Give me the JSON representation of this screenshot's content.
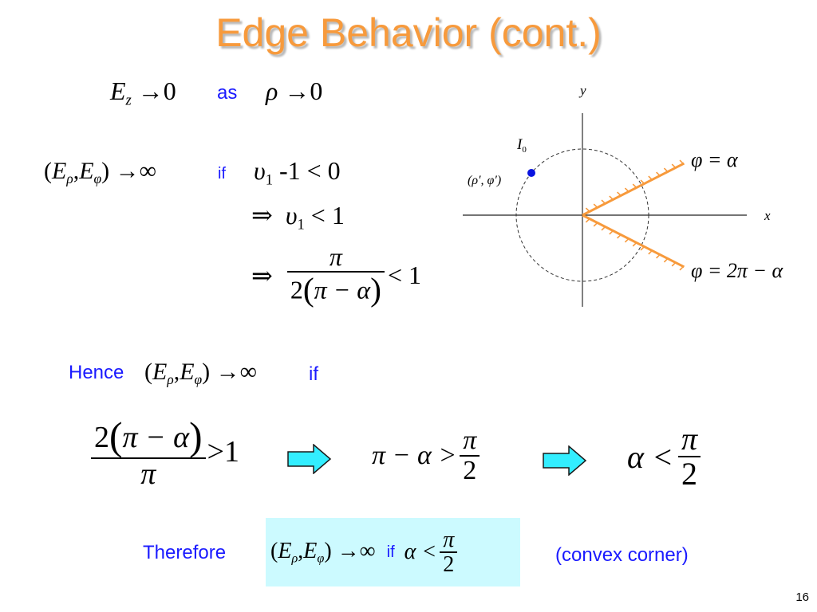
{
  "slide": {
    "title": "Edge Behavior (cont.)",
    "page_number": "16",
    "colors": {
      "title": "#f79a3c",
      "title_shadow": "#b8b8b8",
      "keyword_text": "#1a1aff",
      "edge_lines": "#f79a3c",
      "source_point": "#0a14e0",
      "arrow_fill": "#33eeff",
      "highlight_box": "#ccfaff"
    }
  },
  "line1": {
    "lhs_E": "E",
    "lhs_sub": "z",
    "arrow": "→",
    "rhs": "0",
    "keyword": "as",
    "var": "ρ",
    "var_arrow": "→",
    "var_rhs": "0"
  },
  "line2": {
    "lhs": {
      "open": "(",
      "E1": "E",
      "sub1": "ρ",
      "comma": ",",
      "E2": "E",
      "sub2": "φ",
      "close": ")",
      "arrow": "→",
      "inf": "∞"
    },
    "keyword": "if",
    "cond": {
      "nu": "υ",
      "sub": "1",
      "rest": " -1 < 0"
    }
  },
  "line3": {
    "implies": "⇒",
    "nu": "υ",
    "sub": "1",
    "rest": " < 1"
  },
  "line4": {
    "implies": "⇒",
    "num": "π",
    "den_pre": "2",
    "den_paren_open": "(",
    "den_inner": "π − α",
    "den_paren_close": ")",
    "rest": "< 1"
  },
  "diagram": {
    "y_label": "y",
    "x_label": "x",
    "source_label": "I",
    "source_sub": "0",
    "source_coords": "(ρ′, φ′)",
    "edge_upper_label": "φ = α",
    "edge_lower_label": "φ = 2π − α"
  },
  "hence": {
    "keyword": "Hence",
    "lhs": {
      "open": "(",
      "E1": "E",
      "sub1": "ρ",
      "comma": ",",
      "E2": "E",
      "sub2": "φ",
      "close": ")",
      "arrow": "→",
      "inf": "∞"
    },
    "if": "if"
  },
  "chain": {
    "step1": {
      "num_pre": "2",
      "num_open": "(",
      "num_inner": "π − α",
      "num_close": ")",
      "den": "π",
      "rest": ">1"
    },
    "step2": {
      "lhs": "π − α >",
      "num": "π",
      "den": "2"
    },
    "step3": {
      "lhs": "α <",
      "num": "π",
      "den": "2"
    },
    "arrows": [
      "right-arrow",
      "right-arrow"
    ]
  },
  "conclusion": {
    "keyword": "Therefore",
    "lhs": {
      "open": "(",
      "E1": "E",
      "sub1": "ρ",
      "comma": ",",
      "E2": "E",
      "sub2": "φ",
      "close": ")",
      "arrow": "→",
      "inf": "∞"
    },
    "if": "if",
    "cond_lhs": "α <",
    "cond_num": "π",
    "cond_den": "2",
    "note": "(convex corner)"
  }
}
